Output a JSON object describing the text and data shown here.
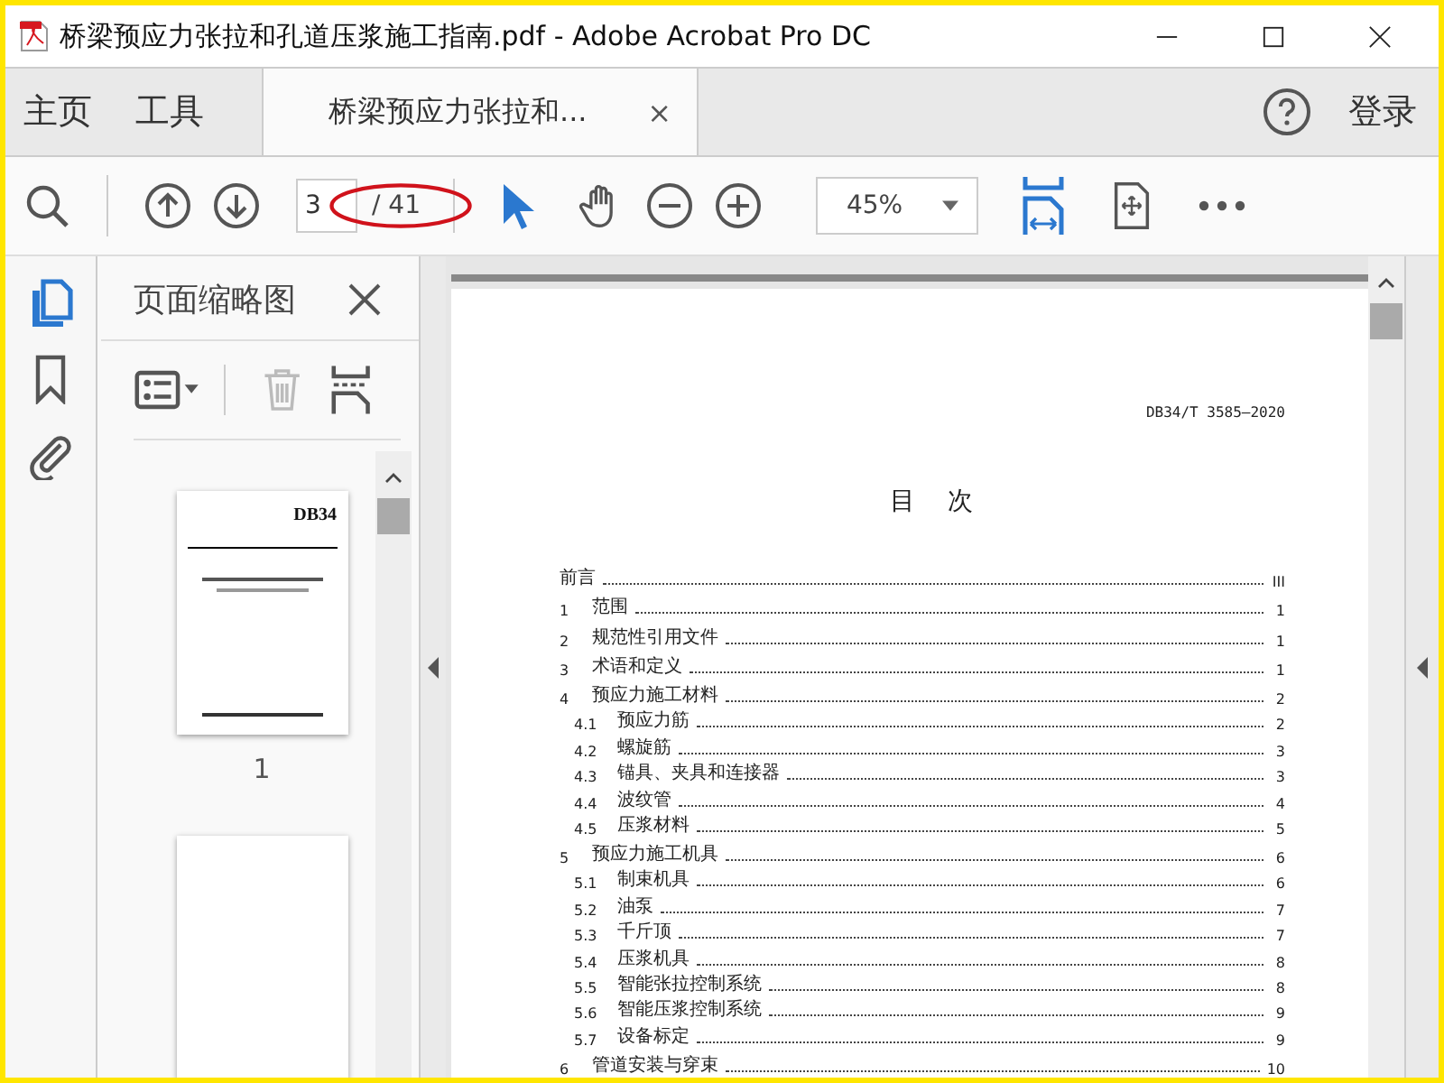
{
  "window": {
    "title": "桥梁预应力张拉和孔道压浆施工指南.pdf - Adobe Acrobat Pro DC"
  },
  "nav_tabs": [
    {
      "label": "主页",
      "selected": false
    },
    {
      "label": "工具",
      "selected": false
    }
  ],
  "doc_tab": {
    "label": "桥梁预应力张拉和...",
    "close": "×",
    "selected": true
  },
  "sign_in": "登录",
  "toolbar": {
    "page_value": "3",
    "page_total": "/ 41",
    "zoom": "45%"
  },
  "panel": {
    "title": "页面缩略图",
    "thumbnails": [
      {
        "kind": "cover",
        "label": "1",
        "heading": "DB34"
      },
      {
        "kind": "blank"
      }
    ]
  },
  "document": {
    "code": "DB34/T 3585—2020",
    "heading": "目　次",
    "toc": [
      {
        "kind": "chapter",
        "title": "前言",
        "page": "III"
      },
      {
        "kind": "chapter",
        "num": "1",
        "title": "范围",
        "page": "1"
      },
      {
        "kind": "chapter",
        "num": "2",
        "title": "规范性引用文件",
        "page": "1"
      },
      {
        "kind": "chapter",
        "num": "3",
        "title": "术语和定义",
        "page": "1"
      },
      {
        "kind": "chapter",
        "num": "4",
        "title": "预应力施工材料",
        "page": "2"
      },
      {
        "kind": "section",
        "num": "4.1",
        "title": "预应力筋",
        "page": "2"
      },
      {
        "kind": "section",
        "num": "4.2",
        "title": "螺旋筋",
        "page": "3"
      },
      {
        "kind": "section",
        "num": "4.3",
        "title": "锚具、夹具和连接器",
        "page": "3"
      },
      {
        "kind": "section",
        "num": "4.4",
        "title": "波纹管",
        "page": "4"
      },
      {
        "kind": "section",
        "num": "4.5",
        "title": "压浆材料",
        "page": "5"
      },
      {
        "kind": "chapter",
        "num": "5",
        "title": "预应力施工机具",
        "page": "6"
      },
      {
        "kind": "section",
        "num": "5.1",
        "title": "制束机具",
        "page": "6"
      },
      {
        "kind": "section",
        "num": "5.2",
        "title": "油泵",
        "page": "7"
      },
      {
        "kind": "section",
        "num": "5.3",
        "title": "千斤顶",
        "page": "7"
      },
      {
        "kind": "section",
        "num": "5.4",
        "title": "压浆机具",
        "page": "8"
      },
      {
        "kind": "section",
        "num": "5.5",
        "title": "智能张拉控制系统",
        "page": "8"
      },
      {
        "kind": "section",
        "num": "5.6",
        "title": "智能压浆控制系统",
        "page": "9"
      },
      {
        "kind": "section",
        "num": "5.7",
        "title": "设备标定",
        "page": "9"
      },
      {
        "kind": "chapter",
        "num": "6",
        "title": "管道安装与穿束",
        "page": "10"
      }
    ]
  }
}
